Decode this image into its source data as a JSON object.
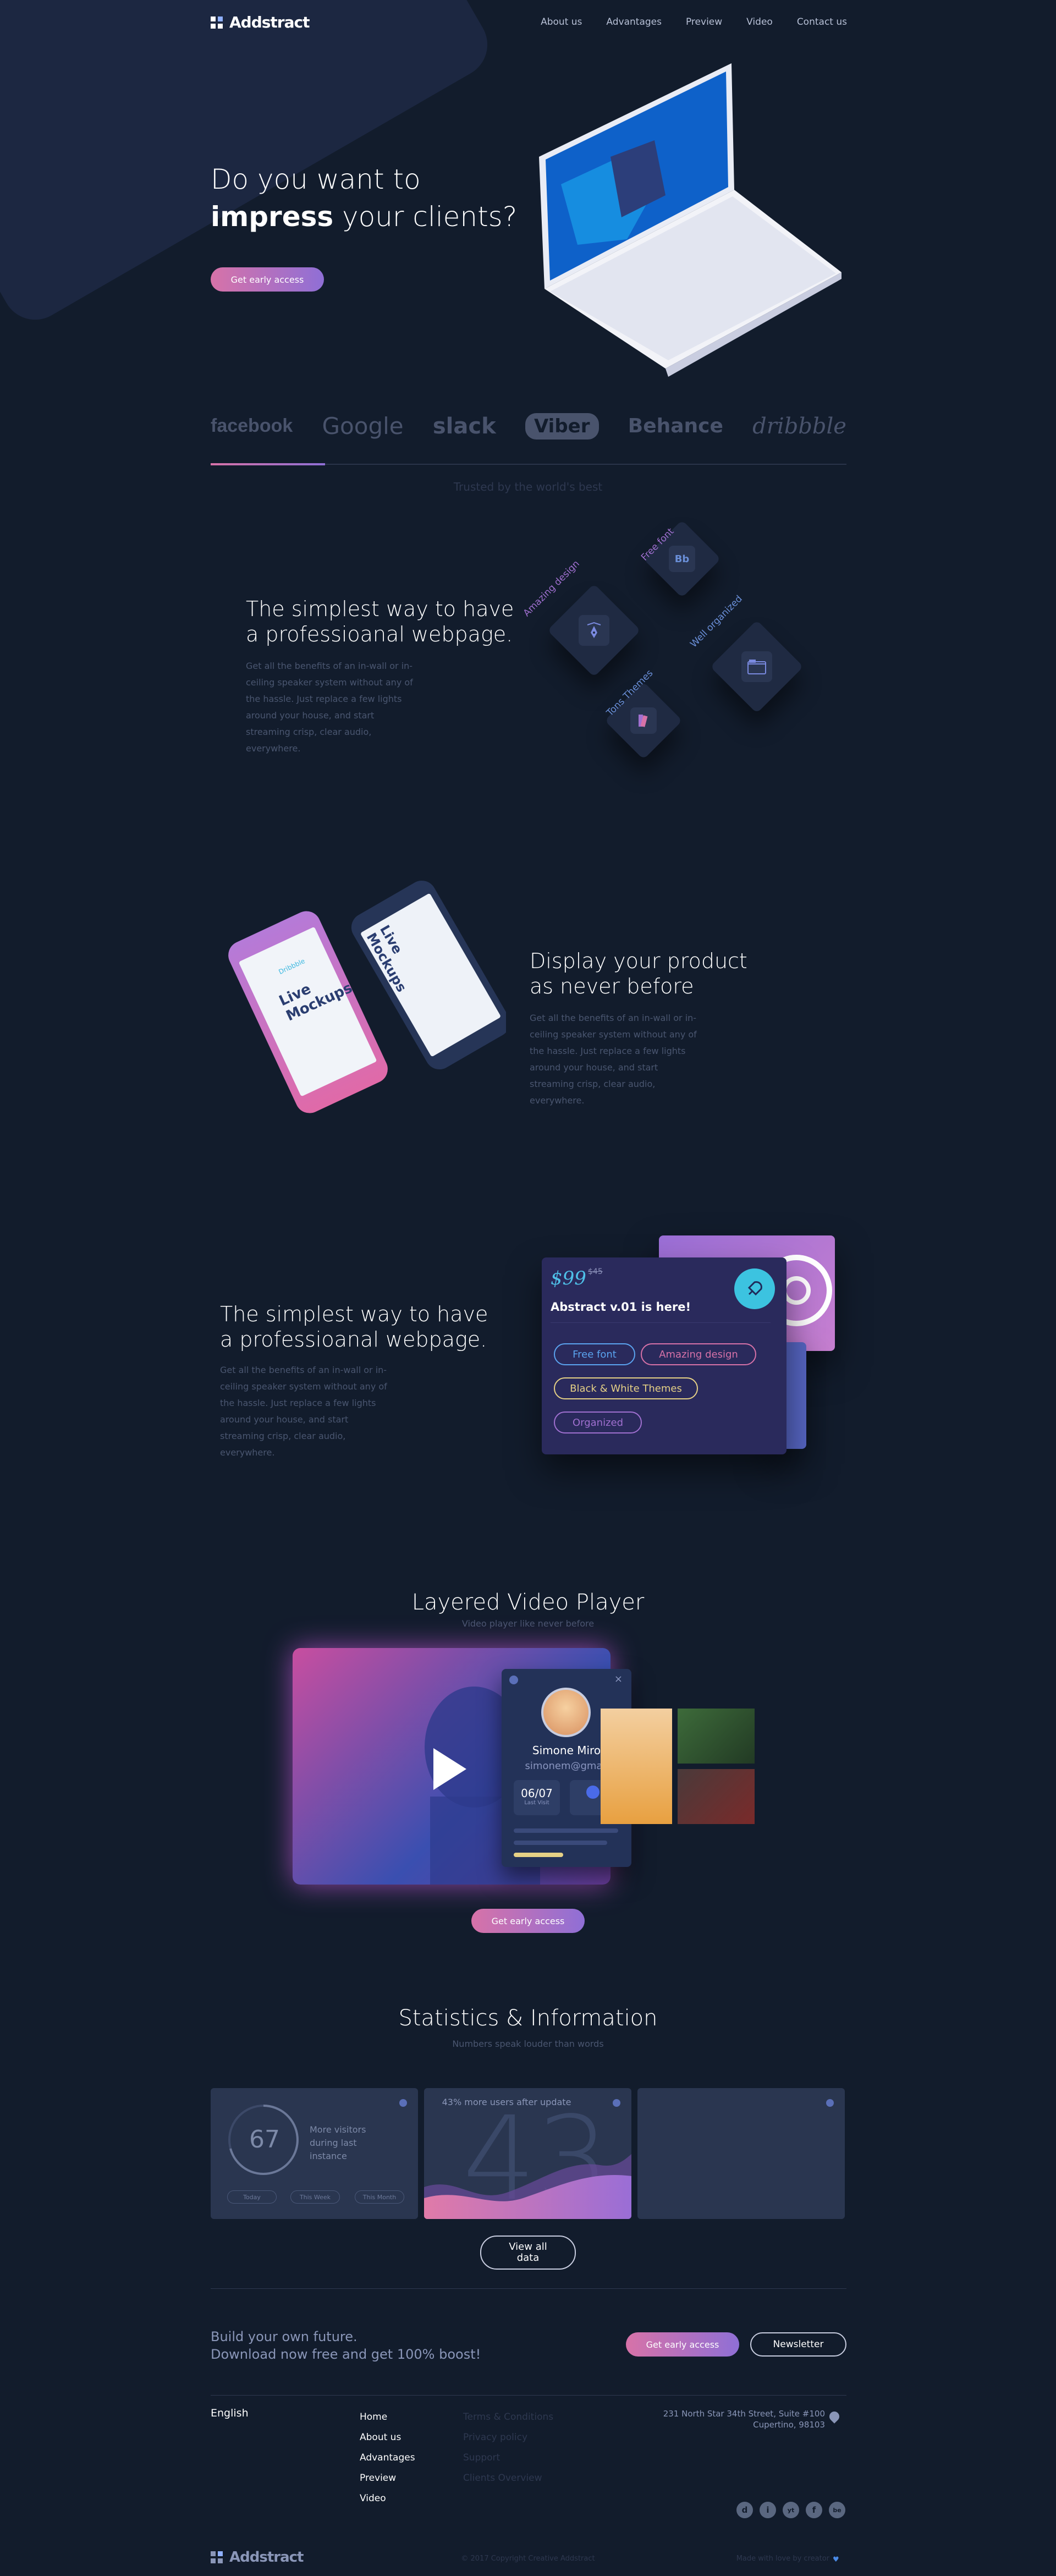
{
  "header": {
    "brand": "Addstract",
    "nav": [
      "About us",
      "Advantages",
      "Preview",
      "Video",
      "Contact us"
    ]
  },
  "hero": {
    "title_line1": "Do you want to",
    "title_bold": "impress",
    "title_rest": " your clients?",
    "cta": "Get early access"
  },
  "brands": {
    "items": [
      "facebook",
      "Google",
      "slack",
      "Viber",
      "Behance",
      "dribbble"
    ],
    "trusted": "Trusted by the world's best"
  },
  "feature1": {
    "title": "The simplest way to have a professioanal webpage.",
    "text": "Get all the benefits of an in-wall or in-ceiling speaker system without any of the hassle. Just replace a few lights around your house, and start streaming crisp, clear audio, everywhere.",
    "labels": [
      "Amazing design",
      "Free font",
      "Well organized",
      "Tons Themes"
    ]
  },
  "feature2": {
    "title": "Display your product as never before",
    "text": "Get all the benefits of an in-wall or in-ceiling speaker system without any of the hassle. Just replace a few lights around your house, and start streaming crisp, clear audio, everywhere.",
    "phone_label": "Live Mockups",
    "phone_small": "Dribbble"
  },
  "feature3": {
    "title": "The simplest way to have a professioanal webpage.",
    "text": "Get all the benefits of an in-wall or in-ceiling speaker system without any of the hassle. Just replace a few lights around your house, and start streaming crisp, clear audio, everywhere.",
    "price": "$99",
    "price_old": "$45",
    "panel_title": "Abstract v.01 is here!",
    "chips": [
      "Free font",
      "Amazing design",
      "Black & White Themes",
      "Organized"
    ]
  },
  "video": {
    "title": "Layered Video Player",
    "subtitle": "Video player like never before",
    "profile_name": "Simone Miro",
    "profile_email": "simonem@gmail",
    "date": "06/07",
    "date_caption": "Last Visit",
    "cta": "Get early access"
  },
  "stats": {
    "title": "Statistics & Information",
    "subtitle": "Numbers speak louder than words",
    "card1_number": "67",
    "card1_text": "More visitors during last instance",
    "card1_tags": [
      "Today",
      "This Week",
      "This Month"
    ],
    "card2_text": "43% more users after update",
    "card2_number": "43",
    "button": "View all data"
  },
  "cta_band": {
    "line1": "Build your own future.",
    "line2": "Download now free and get 100% boost!",
    "primary": "Get early access",
    "secondary": "Newsletter"
  },
  "footer": {
    "language": "English",
    "links": [
      "Home",
      "About us",
      "Advantages",
      "Preview",
      "Video"
    ],
    "links2": [
      "Terms & Conditions",
      "Privacy policy",
      "Support",
      "Clients Overview"
    ],
    "address_line1": "231 North Star 34th Street, Suite #100",
    "address_line2": "Cupertino, 98103",
    "social": [
      "d",
      "i",
      "yt",
      "f",
      "be"
    ],
    "brand": "Addstract",
    "copyright": "© 2017 Copyright Creative Addstract",
    "made": "Made with love by creator"
  },
  "colors": {
    "background": "#121c2c",
    "accent_pink": "#d772a8",
    "accent_purple": "#8f6fd6",
    "muted_text": "#4a5670"
  }
}
